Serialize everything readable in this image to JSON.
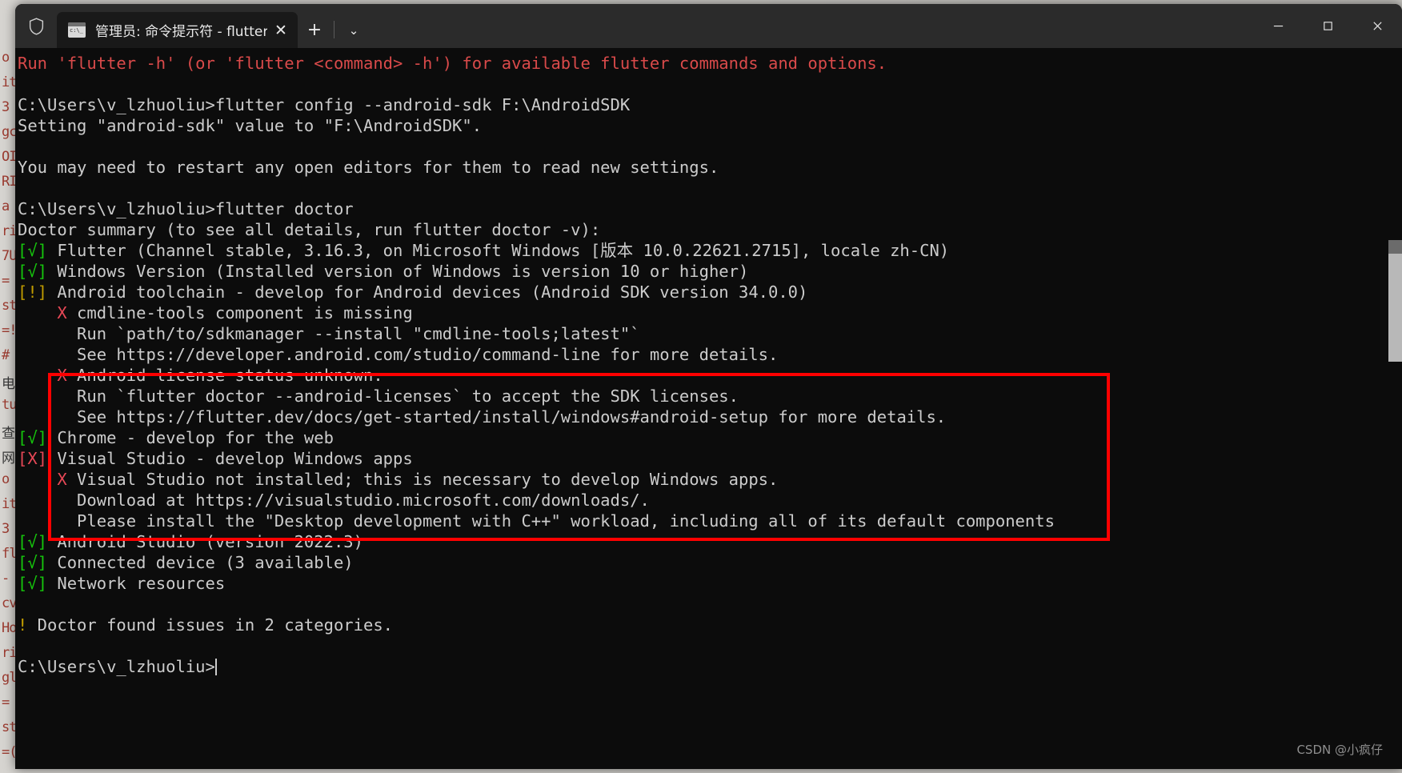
{
  "window": {
    "title_bar": {
      "shield_icon": "shield-icon",
      "tab": {
        "app_icon": "terminal-icon",
        "title": "管理员: 命令提示符 - flutter  d",
        "close_label": "✕"
      },
      "new_tab_label": "+",
      "dropdown_label": "⌄",
      "controls": {
        "minimize": "—",
        "maximize": "☐",
        "close": "✕"
      }
    }
  },
  "terminal": {
    "lines": [
      {
        "id": "flutter-help-hint",
        "segments": [
          {
            "text": "Run 'flutter -h' (or 'flutter <command> -h') for available flutter commands and options.",
            "color": "red"
          }
        ]
      },
      {
        "id": "blank-1",
        "segments": [
          {
            "text": " ",
            "color": "white"
          }
        ]
      },
      {
        "id": "cmd-flutter-config",
        "segments": [
          {
            "text": "C:\\Users\\v_lzhuoliu>flutter config --android-sdk F:\\AndroidSDK",
            "color": "white"
          }
        ]
      },
      {
        "id": "out-setting-sdk",
        "segments": [
          {
            "text": "Setting \"android-sdk\" value to \"F:\\AndroidSDK\".",
            "color": "white"
          }
        ]
      },
      {
        "id": "blank-2",
        "segments": [
          {
            "text": " ",
            "color": "white"
          }
        ]
      },
      {
        "id": "out-restart-editors",
        "segments": [
          {
            "text": "You may need to restart any open editors for them to read new settings.",
            "color": "white"
          }
        ]
      },
      {
        "id": "blank-3",
        "segments": [
          {
            "text": " ",
            "color": "white"
          }
        ]
      },
      {
        "id": "cmd-flutter-doctor",
        "segments": [
          {
            "text": "C:\\Users\\v_lzhuoliu>flutter doctor",
            "color": "white"
          }
        ]
      },
      {
        "id": "doctor-summary",
        "segments": [
          {
            "text": "Doctor summary (to see all details, run flutter doctor -v):",
            "color": "white"
          }
        ]
      },
      {
        "id": "check-flutter",
        "segments": [
          {
            "text": "[√]",
            "color": "green"
          },
          {
            "text": " Flutter (Channel stable, 3.16.3, on Microsoft Windows [版本 10.0.22621.2715], locale zh-CN)",
            "color": "white"
          }
        ]
      },
      {
        "id": "check-windows-version",
        "segments": [
          {
            "text": "[√]",
            "color": "green"
          },
          {
            "text": " Windows Version (Installed version of Windows is version 10 or higher)",
            "color": "white"
          }
        ]
      },
      {
        "id": "check-android-toolchain",
        "segments": [
          {
            "text": "[!]",
            "color": "yellow"
          },
          {
            "text": " Android toolchain - develop for Android devices (Android SDK version 34.0.0)",
            "color": "white"
          }
        ]
      },
      {
        "id": "err-cmdline-tools",
        "segments": [
          {
            "text": "    ",
            "color": "white"
          },
          {
            "text": "X",
            "color": "brightred"
          },
          {
            "text": " cmdline-tools component is missing",
            "color": "white"
          }
        ]
      },
      {
        "id": "fix-cmdline-tools",
        "segments": [
          {
            "text": "      Run `path/to/sdkmanager --install \"cmdline-tools;latest\"`",
            "color": "white"
          }
        ]
      },
      {
        "id": "see-cmdline-tools",
        "segments": [
          {
            "text": "      See https://developer.android.com/studio/command-line for more details.",
            "color": "white"
          }
        ]
      },
      {
        "id": "err-android-license",
        "segments": [
          {
            "text": "    ",
            "color": "white"
          },
          {
            "text": "X",
            "color": "brightred"
          },
          {
            "text": " Android license status unknown.",
            "color": "white"
          }
        ]
      },
      {
        "id": "fix-android-license",
        "segments": [
          {
            "text": "      Run `flutter doctor --android-licenses` to accept the SDK licenses.",
            "color": "white"
          }
        ]
      },
      {
        "id": "see-android-license",
        "segments": [
          {
            "text": "      See https://flutter.dev/docs/get-started/install/windows#android-setup for more details.",
            "color": "white"
          }
        ]
      },
      {
        "id": "check-chrome",
        "segments": [
          {
            "text": "[√]",
            "color": "green"
          },
          {
            "text": " Chrome - develop for the web",
            "color": "white"
          }
        ]
      },
      {
        "id": "check-visual-studio",
        "segments": [
          {
            "text": "[X]",
            "color": "brightred"
          },
          {
            "text": " Visual Studio - develop Windows apps",
            "color": "white"
          }
        ]
      },
      {
        "id": "err-visual-studio",
        "segments": [
          {
            "text": "    ",
            "color": "white"
          },
          {
            "text": "X",
            "color": "brightred"
          },
          {
            "text": " Visual Studio not installed; this is necessary to develop Windows apps.",
            "color": "white"
          }
        ]
      },
      {
        "id": "download-visual-studio",
        "segments": [
          {
            "text": "      Download at https://visualstudio.microsoft.com/downloads/.",
            "color": "white"
          }
        ]
      },
      {
        "id": "install-workload",
        "segments": [
          {
            "text": "      Please install the \"Desktop development with C++\" workload, including all of its default components",
            "color": "white"
          }
        ]
      },
      {
        "id": "check-android-studio",
        "segments": [
          {
            "text": "[√]",
            "color": "green"
          },
          {
            "text": " Android Studio (version 2022.3)",
            "color": "white"
          }
        ]
      },
      {
        "id": "check-connected-device",
        "segments": [
          {
            "text": "[√]",
            "color": "green"
          },
          {
            "text": " Connected device (3 available)",
            "color": "white"
          }
        ]
      },
      {
        "id": "check-network-resources",
        "segments": [
          {
            "text": "[√]",
            "color": "green"
          },
          {
            "text": " Network resources",
            "color": "white"
          }
        ]
      },
      {
        "id": "blank-4",
        "segments": [
          {
            "text": " ",
            "color": "white"
          }
        ]
      },
      {
        "id": "doctor-issues-summary",
        "segments": [
          {
            "text": "!",
            "color": "yellow"
          },
          {
            "text": " Doctor found issues in 2 categories.",
            "color": "white"
          }
        ]
      },
      {
        "id": "blank-5",
        "segments": [
          {
            "text": " ",
            "color": "white"
          }
        ]
      },
      {
        "id": "final-prompt",
        "segments": [
          {
            "text": "C:\\Users\\v_lzhuoliu>",
            "color": "white"
          },
          {
            "text": "CURSOR",
            "color": "cursor"
          }
        ]
      }
    ]
  },
  "annotation": {
    "shape": "rectangle",
    "color": "#fe0000"
  },
  "background_window": {
    "lines": [
      "o",
      "it",
      "3",
      "gc",
      "OI",
      "RI",
      "a",
      "rit",
      "7U",
      "=",
      "st=",
      "=!",
      "#",
      "电",
      "tu",
      "查",
      "网",
      "o",
      "it",
      "3",
      "fl",
      "-",
      "cv",
      "Ho",
      "rit",
      "gl",
      "=",
      "st=",
      "=("
    ]
  },
  "watermark": {
    "text": "CSDN @小疯仔"
  },
  "scrollbar": {
    "orientation": "vertical"
  }
}
